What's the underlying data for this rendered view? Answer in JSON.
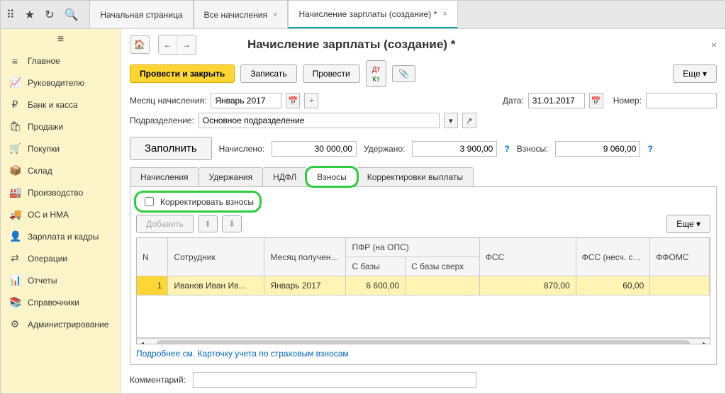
{
  "topbar_tabs": [
    {
      "label": "Начальная страница",
      "close": ""
    },
    {
      "label": "Все начисления",
      "close": "×"
    },
    {
      "label": "Начисление зарплаты (создание) *",
      "close": "×",
      "active": true
    }
  ],
  "sidebar": [
    {
      "icon": "≡",
      "label": "Главное"
    },
    {
      "icon": "📈",
      "label": "Руководителю"
    },
    {
      "icon": "₽",
      "label": "Банк и касса"
    },
    {
      "icon": "🛍",
      "label": "Продажи"
    },
    {
      "icon": "🛒",
      "label": "Покупки"
    },
    {
      "icon": "📦",
      "label": "Склад"
    },
    {
      "icon": "🏭",
      "label": "Производство"
    },
    {
      "icon": "🚚",
      "label": "ОС и НМА"
    },
    {
      "icon": "👤",
      "label": "Зарплата и кадры"
    },
    {
      "icon": "⇄",
      "label": "Операции"
    },
    {
      "icon": "📊",
      "label": "Отчеты"
    },
    {
      "icon": "📚",
      "label": "Справочники"
    },
    {
      "icon": "⚙",
      "label": "Администрирование"
    }
  ],
  "page_title": "Начисление зарплаты (создание) *",
  "cmd": {
    "primary": "Провести и закрыть",
    "record": "Записать",
    "post": "Провести",
    "more": "Еще ▾"
  },
  "month_label": "Месяц начисления:",
  "month_value": "Январь 2017",
  "date_label": "Дата:",
  "date_value": "31.01.2017",
  "number_label": "Номер:",
  "number_value": "",
  "dept_label": "Подразделение:",
  "dept_value": "Основное подразделение",
  "fill_label": "Заполнить",
  "accrued_label": "Начислено:",
  "accrued_value": "30 000,00",
  "withheld_label": "Удержано:",
  "withheld_value": "3 900,00",
  "contrib_label": "Взносы:",
  "contrib_value": "9 060,00",
  "tabs": {
    "t1": "Начисления",
    "t2": "Удержания",
    "t3": "НДФЛ",
    "t4": "Взносы",
    "t5": "Корректировки выплаты"
  },
  "chk_adjust": "Корректировать взносы",
  "add_btn": "Добавить",
  "table": {
    "headers": {
      "n": "N",
      "employee": "Сотрудник",
      "month": "Месяц получения ...",
      "pfr": "ПФР (на ОПС)",
      "pfr_base": "С базы",
      "pfr_over": "С базы сверх",
      "fss": "ФСС",
      "fss_acc": "ФСС (несч. случ.)",
      "ffoms": "ФФОМС"
    },
    "row": {
      "n": "1",
      "employee": "Иванов Иван Ив...",
      "month": "Январь 2017",
      "pfr_base": "6 600,00",
      "pfr_over": "",
      "fss": "870,00",
      "fss_acc": "60,00",
      "ffoms": ""
    }
  },
  "link": "Подробнее см. Карточку учета по страховым взносам",
  "comment_label": "Комментарий:",
  "comment_value": ""
}
